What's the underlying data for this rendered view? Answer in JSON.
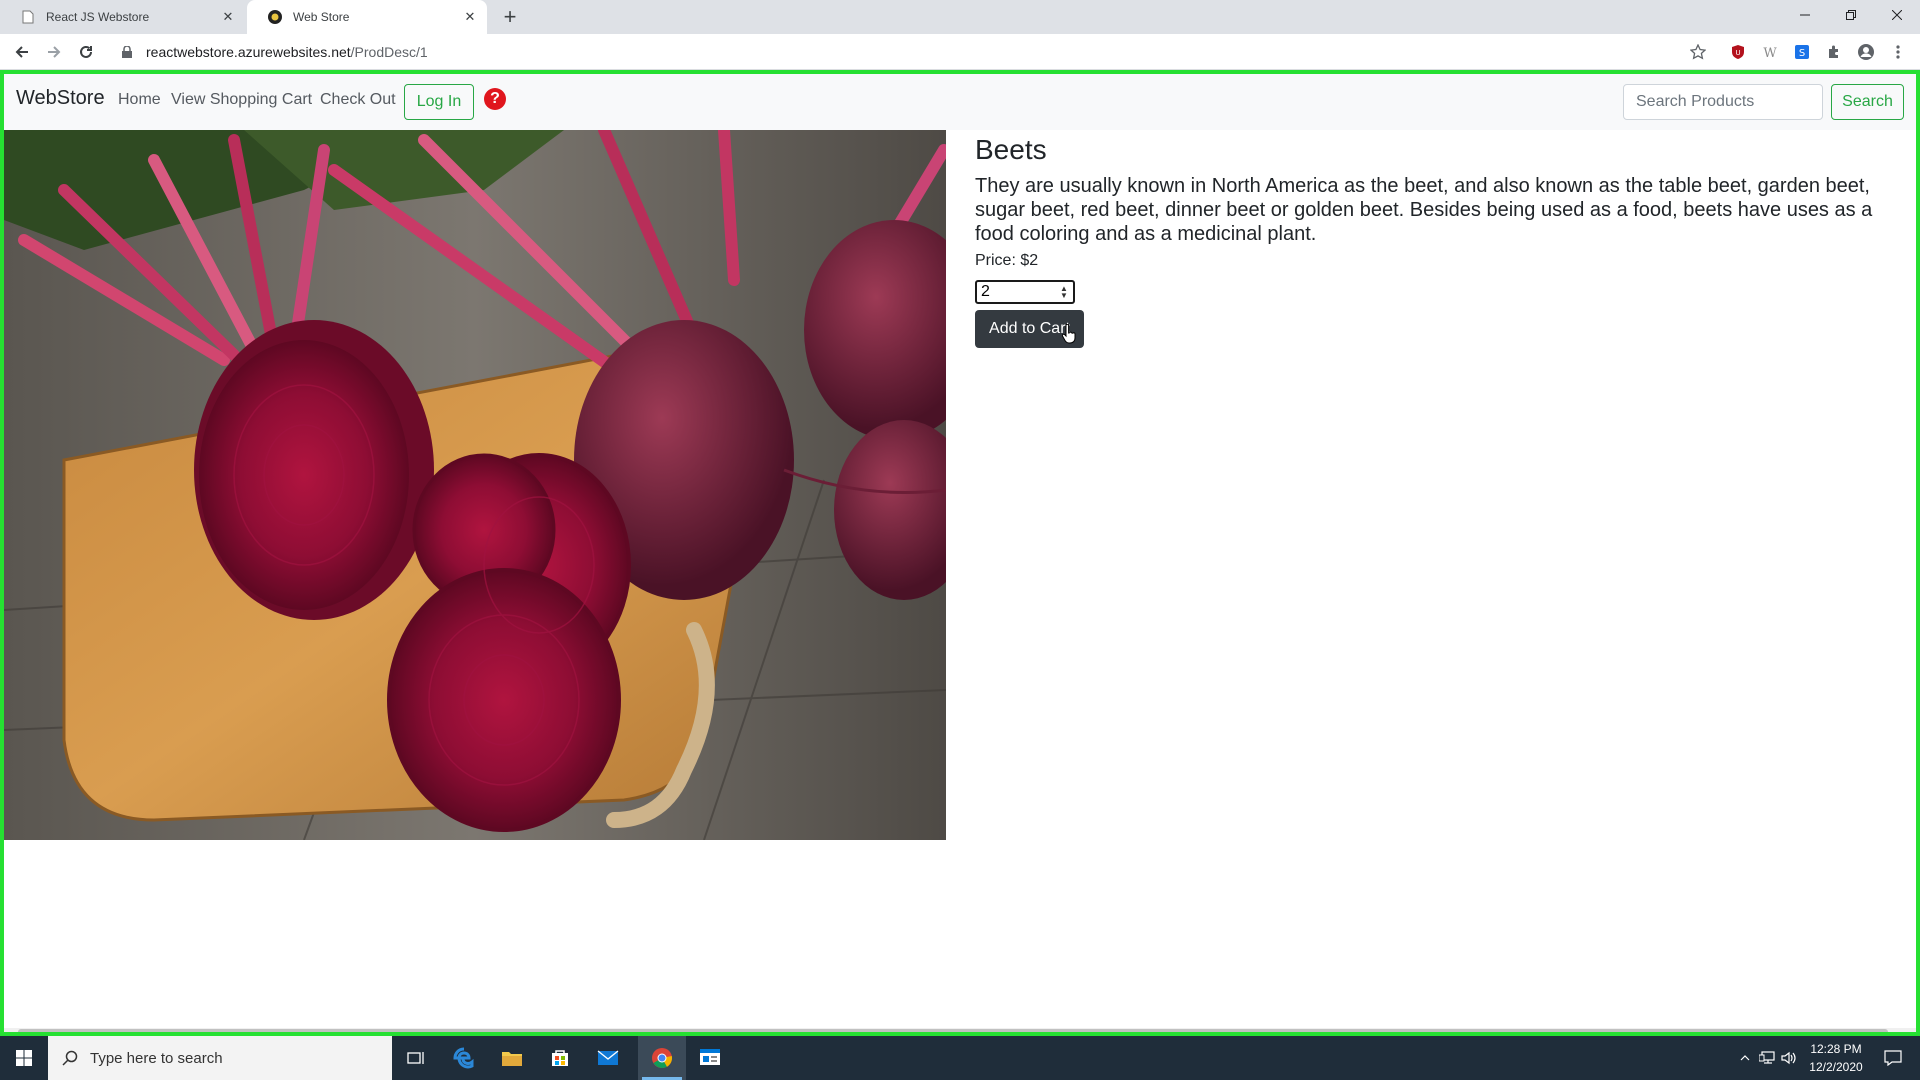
{
  "browser": {
    "tabs": [
      {
        "title": "React JS Webstore",
        "active": false
      },
      {
        "title": "Web Store",
        "active": true
      }
    ],
    "url_host": "reactwebstore.azurewebsites.net",
    "url_path": "/ProdDesc/1"
  },
  "navbar": {
    "brand": "WebStore",
    "links": [
      "Home",
      "View Shopping Cart",
      "Check Out"
    ],
    "login_label": "Log In",
    "help_symbol": "?",
    "search_placeholder": "Search Products",
    "search_label": "Search"
  },
  "product": {
    "name": "Beets",
    "description": "They are usually known in North America as the beet, and also known as the table beet, garden beet, sugar beet, red beet, dinner beet or golden beet. Besides being used as a food, beets have uses as a food coloring and as a medicinal plant.",
    "price_text": "Price: $2",
    "quantity": "2",
    "add_to_cart_label": "Add to Cart"
  },
  "taskbar": {
    "search_placeholder": "Type here to search",
    "time": "12:28 PM",
    "date": "12/2/2020"
  },
  "colors": {
    "accent_green": "#28a745",
    "focus_border": "#26e032",
    "dark_button": "#343a40",
    "help_red": "#e0161d"
  }
}
